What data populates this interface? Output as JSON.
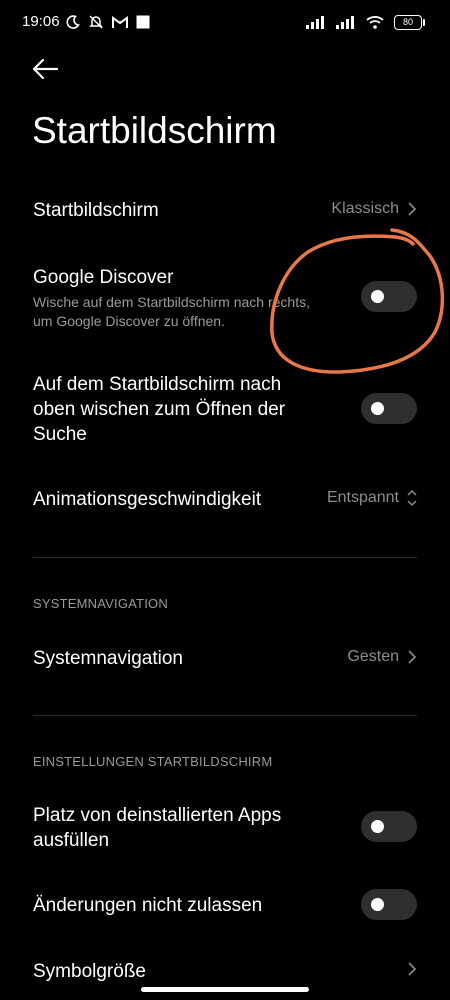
{
  "status_bar": {
    "time": "19:06",
    "battery": "80",
    "left_icons": [
      "moon-icon",
      "bell-off-icon",
      "gmail-icon",
      "square-icon"
    ],
    "right_icons": [
      "signal-icon",
      "signal-icon",
      "wifi-icon",
      "battery-icon"
    ]
  },
  "header": {
    "back_icon": "back-arrow-icon",
    "title": "Startbildschirm"
  },
  "rows": {
    "home_screen": {
      "label": "Startbildschirm",
      "value": "Klassisch"
    },
    "google_discover": {
      "label": "Google Discover",
      "subtitle_line1": "Wische auf dem Startbildschirm nach rechts,",
      "subtitle_line2": "um Google Discover zu öffnen.",
      "enabled": false
    },
    "swipe_search": {
      "line1": "Auf dem Startbildschirm nach",
      "line2": "oben wischen zum Öffnen der",
      "line3": "Suche",
      "enabled": false
    },
    "animation_speed": {
      "label": "Animationsgeschwindigkeit",
      "value": "Entspannt"
    }
  },
  "sections": {
    "system_navigation": {
      "header": "SYSTEMNAVIGATION",
      "row": {
        "label": "Systemnavigation",
        "value": "Gesten"
      }
    },
    "home_settings": {
      "header": "EINSTELLUNGEN STARTBILDSCHIRM",
      "fill_uninstalled": {
        "line1": "Platz von deinstallierten Apps",
        "line2": "ausfüllen",
        "enabled": false
      },
      "lock_changes": {
        "label": "Änderungen nicht zulassen",
        "enabled": false
      },
      "icon_size": {
        "label": "Symbolgröße"
      }
    }
  },
  "colors": {
    "background": "#000000",
    "text": "#ffffff",
    "secondary_text": "#9a9a9a",
    "toggle_off": "#2f2f2f",
    "annotation": "#e8784a"
  }
}
